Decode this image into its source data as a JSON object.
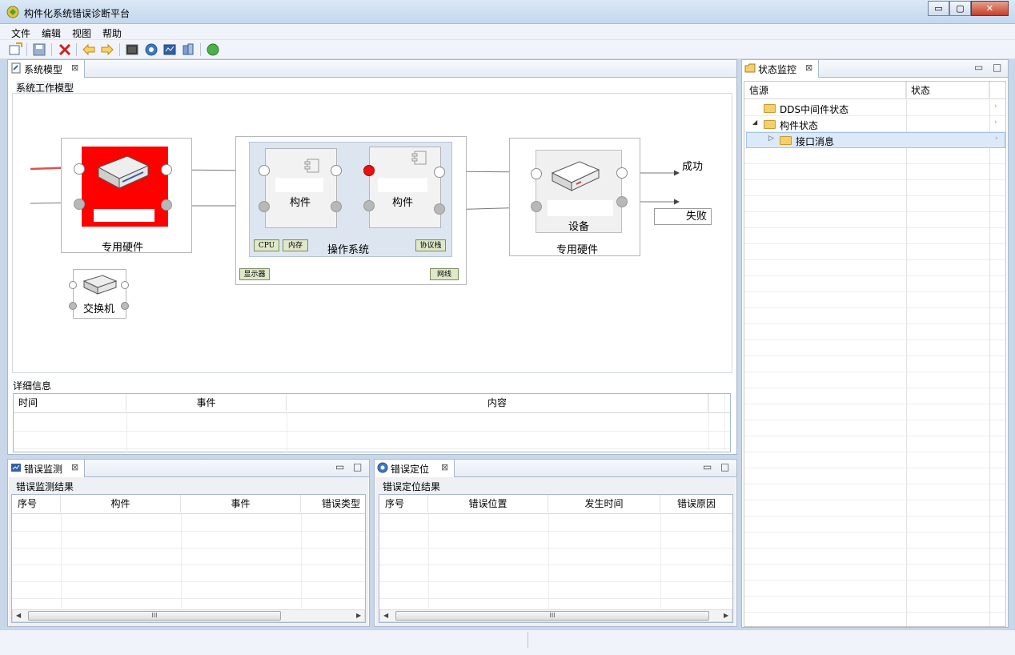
{
  "window": {
    "title": "构件化系统错误诊断平台",
    "min": "▭",
    "max": "▢",
    "close": "✕"
  },
  "menu": {
    "items": [
      "文件",
      "编辑",
      "视图",
      "帮助"
    ]
  },
  "toolbar": {
    "icons": [
      "new-icon",
      "save-icon",
      "delete-icon",
      "back-icon",
      "forward-icon",
      "console-icon",
      "record-icon",
      "monitor-icon",
      "locate-icon",
      "run-icon"
    ]
  },
  "model_view": {
    "tab": "系统模型",
    "section": "系统工作模型",
    "diagram": {
      "hw_left_label": "专用硬件",
      "switch_label": "交换机",
      "comp1_label": "构件",
      "comp2_label": "构件",
      "os_label": "操作系统",
      "chips": {
        "cpu": "CPU",
        "mem": "内存",
        "proto": "协议栈",
        "display": "显示器",
        "net": "网线"
      },
      "device_label": "设备",
      "hw_right_label": "专用硬件",
      "success": "成功",
      "fail": "失败"
    },
    "detail": {
      "title": "详细信息",
      "columns": [
        "时间",
        "事件",
        "内容"
      ]
    }
  },
  "error_monitor": {
    "tab": "错误监测",
    "title": "错误监测结果",
    "columns": [
      "序号",
      "构件",
      "事件",
      "错误类型"
    ],
    "scroll_thumb": "III"
  },
  "error_locate": {
    "tab": "错误定位",
    "title": "错误定位结果",
    "columns": [
      "序号",
      "错误位置",
      "发生时间",
      "错误原因"
    ],
    "scroll_thumb": "III"
  },
  "status_monitor": {
    "tab": "状态监控",
    "columns": [
      "信源",
      "状态"
    ],
    "tree": [
      {
        "label": "DDS中间件状态",
        "level": 0,
        "expanded": false,
        "selected": false
      },
      {
        "label": "构件状态",
        "level": 0,
        "expanded": true,
        "selected": false
      },
      {
        "label": "接口消息",
        "level": 1,
        "expanded": false,
        "selected": true
      }
    ]
  },
  "colors": {
    "accent": "#3f78c4",
    "error_red": "#ff0000",
    "selected_row": "#dbe9f8"
  }
}
